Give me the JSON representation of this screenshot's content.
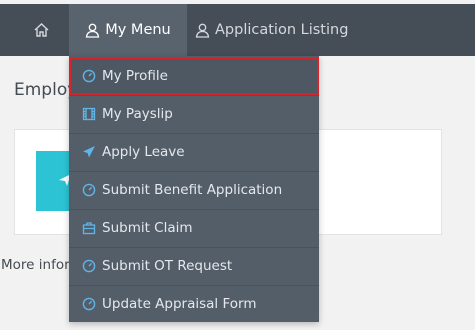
{
  "nav": {
    "home_icon": "home-icon",
    "my_menu_label": "My Menu",
    "application_listing_label": "Application Listing"
  },
  "page": {
    "heading": "Employ",
    "more_info": "More infor"
  },
  "dropdown": {
    "items": [
      {
        "label": "My Profile",
        "icon": "dashboard-gauge-icon"
      },
      {
        "label": "My Payslip",
        "icon": "film-document-icon"
      },
      {
        "label": "Apply Leave",
        "icon": "plane-icon"
      },
      {
        "label": "Submit Benefit Application",
        "icon": "dashboard-gauge-icon"
      },
      {
        "label": "Submit Claim",
        "icon": "briefcase-icon"
      },
      {
        "label": "Submit OT Request",
        "icon": "dashboard-gauge-icon"
      },
      {
        "label": "Update Appraisal Form",
        "icon": "dashboard-gauge-icon"
      }
    ]
  },
  "colors": {
    "topbar": "#454d57",
    "active_tab": "#59636e",
    "dropdown_bg": "#545e69",
    "icon_blue": "#5fb4e8",
    "highlight_border": "#d9232a",
    "tile": "#2cc4d4"
  }
}
